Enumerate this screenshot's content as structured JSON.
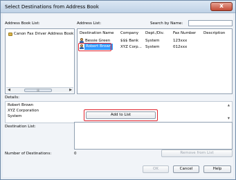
{
  "window": {
    "title": "Select Destinations from Address Book",
    "close_glyph": "x"
  },
  "address_book_list": {
    "label": "Address Book List:",
    "items": [
      "Canon Fax Driver Address Book"
    ]
  },
  "address_list": {
    "label": "Address List:",
    "columns": [
      "Destination Name",
      "Company",
      "Dept./Div.",
      "Fax Number",
      "Description"
    ],
    "rows": [
      {
        "name": "Bessie Green",
        "company": "$$$ Bank",
        "dept": "System",
        "fax": "123xxx",
        "description": ""
      },
      {
        "name": "Robert Brown",
        "company": "XYZ Corp...",
        "dept": "System",
        "fax": "012xxx",
        "description": "",
        "selected": true
      }
    ]
  },
  "search": {
    "label": "Search by Name:",
    "value": ""
  },
  "details": {
    "label": "Details:",
    "lines": [
      "Robert Brown",
      "XYZ Corporation",
      "System"
    ]
  },
  "add_to_list_label": "Add to List",
  "destination_list": {
    "label": "Destination List:"
  },
  "number_of_destinations": {
    "label": "Number of Destinations:",
    "value": "0"
  },
  "remove_from_list_label": "Remove from List",
  "footer": {
    "ok_label": "OK",
    "cancel_label": "Cancel",
    "help_label": "Help"
  },
  "colors": {
    "highlight": "#e0202a",
    "selection": "#3399ff"
  }
}
